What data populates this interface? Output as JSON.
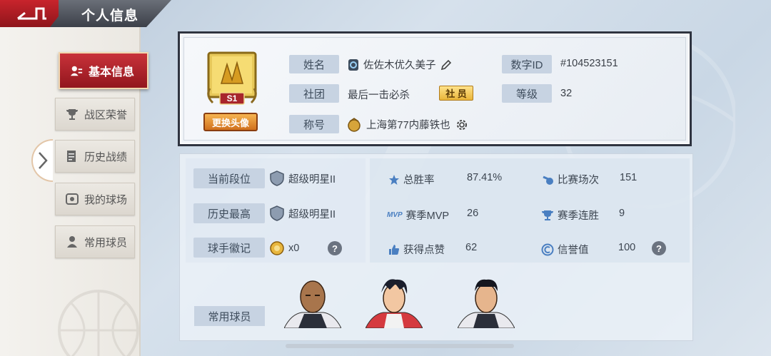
{
  "header": {
    "title": "个人信息"
  },
  "sidebar": {
    "items": [
      {
        "label": "基本信息",
        "icon": "id-card-icon",
        "active": true
      },
      {
        "label": "战区荣誉",
        "icon": "trophy-icon",
        "active": false
      },
      {
        "label": "历史战绩",
        "icon": "record-icon",
        "active": false
      },
      {
        "label": "我的球场",
        "icon": "court-icon",
        "active": false
      },
      {
        "label": "常用球员",
        "icon": "player-icon",
        "active": false
      }
    ]
  },
  "profile": {
    "avatar_season_badge": "S1",
    "change_avatar_label": "更换头像",
    "name_label": "姓名",
    "name_value": "佐佐木优久美子",
    "club_label": "社团",
    "club_value": "最后一击必杀",
    "club_role": "社 员",
    "title_label": "称号",
    "title_value": "上海第77内藤铁也",
    "id_label": "数字ID",
    "id_value": "#104523151",
    "level_label": "等级",
    "level_value": "32"
  },
  "stats": {
    "rank_label": "当前段位",
    "rank_value": "超级明星II",
    "best_label": "历史最高",
    "best_value": "超级明星II",
    "emblem_label": "球手徽记",
    "emblem_value": "x0",
    "winrate_label": "总胜率",
    "winrate_value": "87.41%",
    "mvp_prefix": "MVP",
    "mvp_label": "赛季MVP",
    "mvp_value": "26",
    "likes_label": "获得点赞",
    "likes_value": "62",
    "matches_label": "比赛场次",
    "matches_value": "151",
    "streak_label": "赛季连胜",
    "streak_value": "9",
    "credit_label": "信誉值",
    "credit_value": "100",
    "help_glyph": "?"
  },
  "players": {
    "label": "常用球员"
  },
  "colors": {
    "accent_red": "#b3222a",
    "label_bg": "#c7d3e2",
    "gold": "#e9b53a"
  }
}
